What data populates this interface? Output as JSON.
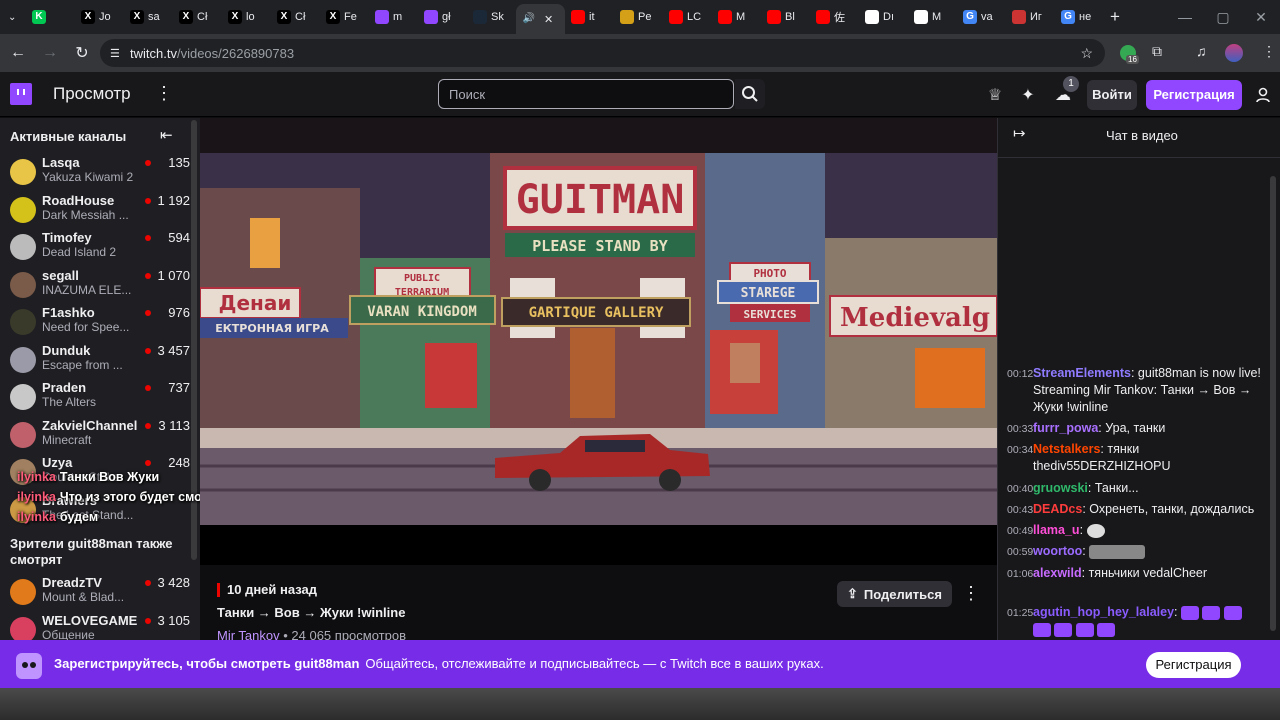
{
  "browser": {
    "tabs": [
      {
        "label": "",
        "color": "#00c853",
        "glyph": "K"
      },
      {
        "label": "Jo",
        "color": "#000000",
        "glyph": "X"
      },
      {
        "label": "sa",
        "color": "#000000",
        "glyph": "X"
      },
      {
        "label": "Cł",
        "color": "#000000",
        "glyph": "X"
      },
      {
        "label": "lo",
        "color": "#000000",
        "glyph": "X"
      },
      {
        "label": "Cł",
        "color": "#000000",
        "glyph": "X"
      },
      {
        "label": "Fe",
        "color": "#000000",
        "glyph": "X"
      },
      {
        "label": "m",
        "color": "#9147ff",
        "glyph": ""
      },
      {
        "label": "gł",
        "color": "#9147ff",
        "glyph": ""
      },
      {
        "label": "Sk",
        "color": "#1b2838",
        "glyph": ""
      },
      {
        "label": "",
        "color": "#35363a",
        "glyph": "🔊"
      },
      {
        "label": "it",
        "color": "#ff0000",
        "glyph": ""
      },
      {
        "label": "Pe",
        "color": "#d4a017",
        "glyph": ""
      },
      {
        "label": "LC",
        "color": "#ff0000",
        "glyph": ""
      },
      {
        "label": "M",
        "color": "#ff0000",
        "glyph": ""
      },
      {
        "label": "Bl",
        "color": "#ff0000",
        "glyph": ""
      },
      {
        "label": "佐",
        "color": "#ff0000",
        "glyph": ""
      },
      {
        "label": "Dı",
        "color": "#ffffff",
        "glyph": ""
      },
      {
        "label": "M",
        "color": "#ffffff",
        "glyph": ""
      },
      {
        "label": "va",
        "color": "#4285f4",
        "glyph": "G"
      },
      {
        "label": "Иг",
        "color": "#cc3333",
        "glyph": ""
      },
      {
        "label": "не",
        "color": "#4285f4",
        "glyph": "G"
      }
    ],
    "new_tab": "+",
    "url_host": "twitch.tv",
    "url_path": "/videos/2626890783",
    "ext_badge": "16"
  },
  "twitch": {
    "browse": "Просмотр",
    "search_placeholder": "Поиск",
    "notif_count": "1",
    "login": "Войти",
    "register": "Регистрация"
  },
  "sidebar": {
    "active_title": "Активные каналы",
    "channels": [
      {
        "name": "Lasqa",
        "game": "Yakuza Kiwami 2",
        "viewers": "135",
        "color": "#e8c547"
      },
      {
        "name": "RoadHouse",
        "game": "Dark Messiah ...",
        "viewers": "1 192",
        "color": "#d4c21a"
      },
      {
        "name": "Timofey",
        "game": "Dead Island 2",
        "viewers": "594",
        "color": "#bbbbbb"
      },
      {
        "name": "segall",
        "game": "INAZUMA ELE...",
        "viewers": "1 070",
        "color": "#7a5a48"
      },
      {
        "name": "F1ashko",
        "game": "Need for Spee...",
        "viewers": "976",
        "color": "#3a3a2a"
      },
      {
        "name": "Dunduk",
        "game": "Escape from ...",
        "viewers": "3 457",
        "color": "#9a9aa8"
      },
      {
        "name": "Praden",
        "game": "The Alters",
        "viewers": "737",
        "color": "#c8c8c8"
      },
      {
        "name": "ZakvielChannel",
        "game": "Minecraft",
        "viewers": "3 113",
        "color": "#c0606a"
      },
      {
        "name": "Uzya",
        "game": "Counter-Strike",
        "viewers": "248",
        "color": "#a08060"
      },
      {
        "name": "Brawlers",
        "game": "The Last Stand...",
        "viewers": "",
        "color": "#cc9944"
      }
    ],
    "also_title": "Зрители guit88man также смотрят",
    "also_channels": [
      {
        "name": "DreadzTV",
        "game": "Mount & Blad...",
        "viewers": "3 428",
        "color": "#e07a1a"
      },
      {
        "name": "WELOVEGAMES",
        "game": "Общение",
        "viewers": "3 105",
        "color": "#d94060"
      }
    ]
  },
  "overlay_chat": [
    {
      "nick": "ilyinka",
      "text": "Танки Вов Жуки"
    },
    {
      "nick": "ilyinka",
      "text": "Что из этого будет смотреть"
    },
    {
      "nick": "ilyinka",
      "text": "будем"
    }
  ],
  "video": {
    "signs": {
      "guitman": "GUITMAN",
      "stand_by": "PLEASE STAND BY",
      "public": "PUBLIC",
      "terrarium": "TERRARIUM",
      "varan": "VARAN KINGDOM",
      "gallery": "GARTIQUE GALLERY",
      "photo": "PHOTO",
      "starege": "STAREGE",
      "services": "SERVICES",
      "medieval": "Medievalg",
      "denai": "Денаи",
      "electronic": "ЕКТРОННАЯ ИГРА"
    },
    "age": "10 дней назад",
    "title": "Танки → Вов → Жуки !winline",
    "channel": "Mir Tankov",
    "views": " • 24 065 просмотров",
    "share": "Поделиться"
  },
  "chat": {
    "title": "Чат в видео",
    "messages": [
      {
        "ts": "00:12",
        "user": "StreamElements",
        "color": "#8f7bff",
        "text": ": guit88man is now live! Streaming Mir Tankov: Танки → Вов → Жуки !winline"
      },
      {
        "ts": "00:33",
        "user": "furrr_powa",
        "color": "#a970ff",
        "text": ": Ура, танки"
      },
      {
        "ts": "00:34",
        "user": "Netstalkers",
        "color": "#ff4500",
        "text": ": тянки thediv55DERZHIZHOPU"
      },
      {
        "ts": "00:40",
        "user": "gruowski",
        "color": "#2fb86a",
        "text": ": Танки..."
      },
      {
        "ts": "00:43",
        "user": "DEADcs",
        "color": "#ff3c3c",
        "text": ": Охренеть, танки, дождались"
      },
      {
        "ts": "00:49",
        "user": "llama_u",
        "color": "#ff4fd8",
        "text": ":"
      },
      {
        "ts": "00:59",
        "user": "woortoo",
        "color": "#9b6bff",
        "text": ":"
      },
      {
        "ts": "01:06",
        "user": "alexwild",
        "color": "#c86bff",
        "text": ": тяньчики vedalCheer"
      },
      {
        "ts": "01:25",
        "user": "agutin_hop_hey_lalaley",
        "color": "#8a5cff",
        "text": ":"
      }
    ]
  },
  "banner": {
    "bold": "Зарегистрируйтесь, чтобы смотреть guit88man",
    "text": "Общайтесь, отслеживайте и подписывайтесь — с Twitch все в ваших руках.",
    "button": "Регистрация"
  }
}
